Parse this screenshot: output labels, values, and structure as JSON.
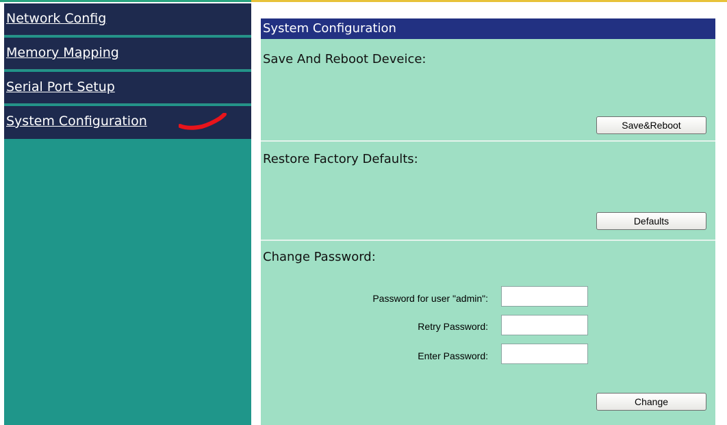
{
  "sidebar": {
    "items": [
      {
        "label": "Network Config"
      },
      {
        "label": "Memory Mapping"
      },
      {
        "label": "Serial Port Setup"
      },
      {
        "label": "System Configuration"
      }
    ]
  },
  "main": {
    "header": "System Configuration",
    "save_reboot": {
      "title": "Save And Reboot Deveice:",
      "button": "Save&Reboot"
    },
    "restore": {
      "title": "Restore Factory Defaults:",
      "button": "Defaults"
    },
    "change_password": {
      "title": "Change Password:",
      "fields": [
        {
          "label": "Password for user \"admin\":",
          "value": ""
        },
        {
          "label": "Retry Password:",
          "value": ""
        },
        {
          "label": "Enter Password:",
          "value": ""
        }
      ],
      "button": "Change"
    }
  },
  "colors": {
    "nav_bg": "#1e2a4e",
    "sidebar_bg": "#1f968a",
    "panel_bg": "#9fdfc4",
    "header_bg": "#223182",
    "annotation_mark": "#e8141b"
  }
}
